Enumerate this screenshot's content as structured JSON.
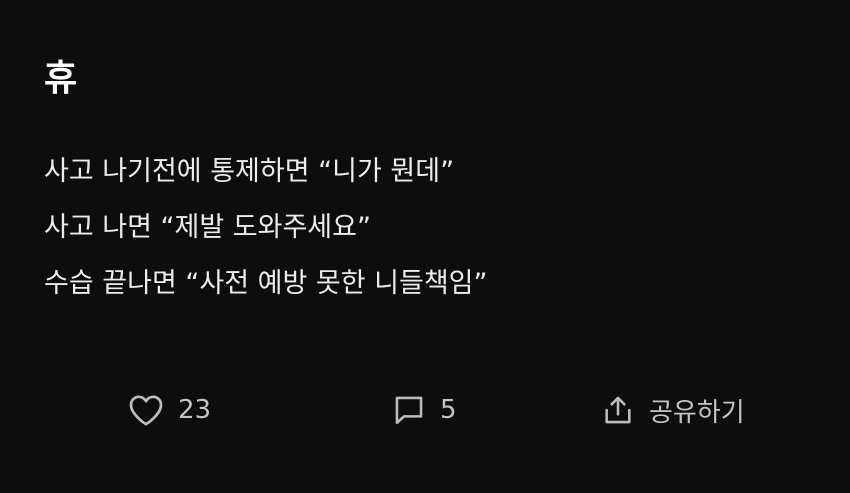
{
  "post": {
    "title": "휴",
    "lines": [
      "사고 나기전에 통제하면 “니가 뭔데”",
      "사고 나면 “제발 도와주세요”",
      "수습 끝나면 “사전 예방 못한 니들책임”"
    ]
  },
  "actions": {
    "like": {
      "icon": "heart-icon",
      "count": "23"
    },
    "comment": {
      "icon": "comment-icon",
      "count": "5"
    },
    "share": {
      "icon": "share-icon",
      "label": "공유하기"
    }
  },
  "colors": {
    "background": "#0d0d0d",
    "text": "#ececec",
    "muted": "#bdbdbd"
  }
}
